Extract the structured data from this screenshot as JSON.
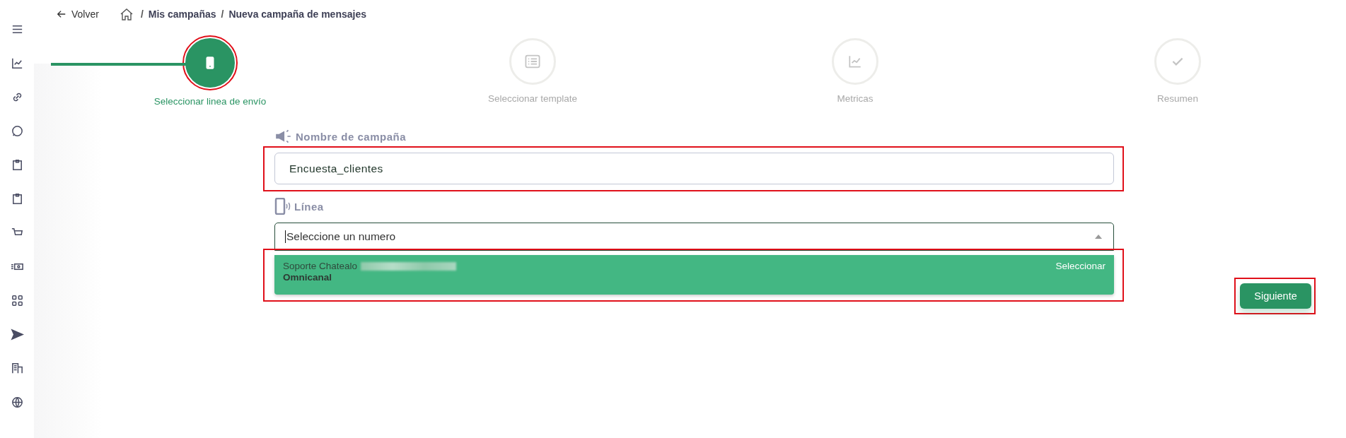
{
  "header": {
    "back": "Volver",
    "breadcrumb": [
      {
        "separator": "/",
        "label": "Mis campañas"
      },
      {
        "separator": "/",
        "label": "Nueva campaña de mensajes"
      }
    ]
  },
  "steps": [
    {
      "label": "Seleccionar linea de envío",
      "selected": true,
      "highlighted": true
    },
    {
      "label": "Seleccionar template",
      "selected": false,
      "highlighted": false
    },
    {
      "label": "Metricas",
      "selected": false,
      "highlighted": false
    },
    {
      "label": "Resumen",
      "selected": false,
      "highlighted": false
    }
  ],
  "campaign_name": {
    "label": "Nombre de campaña",
    "value": "Encuesta_clientes",
    "highlighted": true
  },
  "line": {
    "label": "Línea",
    "placeholder": "Seleccione un numero",
    "expanded": true,
    "options": [
      {
        "name": "Soporte Chatealo",
        "type": "Omnicanal",
        "action": "Seleccionar",
        "selected": true,
        "highlighted": true
      }
    ]
  },
  "next_button": {
    "label": "Siguiente",
    "highlighted": true
  }
}
